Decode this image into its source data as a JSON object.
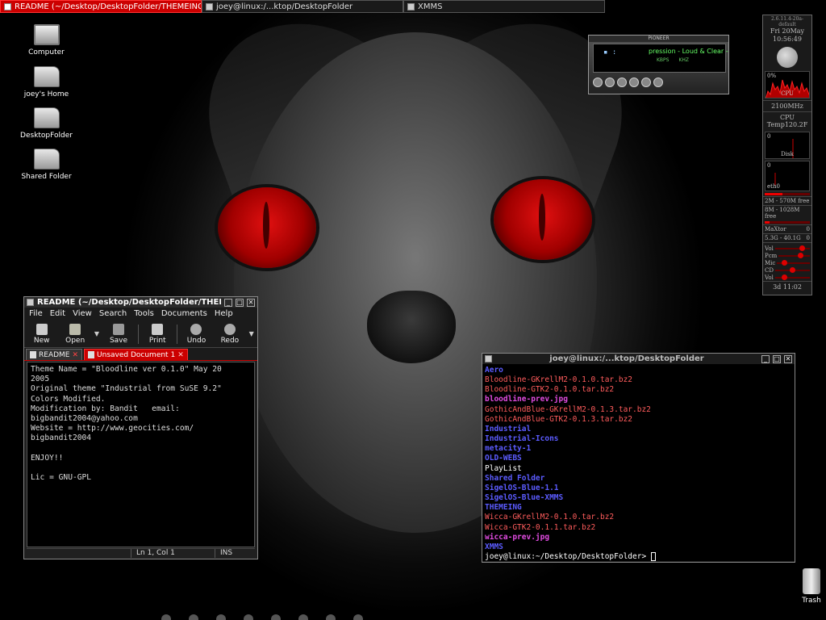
{
  "taskbar": [
    {
      "label": "README (~/Desktop/DesktopFolder/THEMEING/Blo...",
      "active": true
    },
    {
      "label": "joey@linux:/...ktop/DesktopFolder",
      "active": false
    },
    {
      "label": "XMMS",
      "active": false
    }
  ],
  "desktop_icons": [
    {
      "label": "Computer",
      "icon": "computer-icon"
    },
    {
      "label": "joey's Home",
      "icon": "home-folder-icon"
    },
    {
      "label": "DesktopFolder",
      "icon": "folder-icon"
    },
    {
      "label": "Shared Folder",
      "icon": "folder-icon"
    }
  ],
  "trash": {
    "label": "Trash"
  },
  "gedit": {
    "title": "README (~/Desktop/DesktopFolder/THEMEING/",
    "menu": [
      "File",
      "Edit",
      "View",
      "Search",
      "Tools",
      "Documents",
      "Help"
    ],
    "toolbar": {
      "new": "New",
      "open": "Open",
      "save": "Save",
      "print": "Print",
      "undo": "Undo",
      "redo": "Redo"
    },
    "tabs": [
      {
        "label": "README",
        "active": false
      },
      {
        "label": "Unsaved Document 1",
        "active": true
      }
    ],
    "content": "Theme Name = \"Bloodline ver 0.1.0\" May 20\n2005\nOriginal theme \"Industrial from SuSE 9.2\"\nColors Modified.\nModification by: Bandit   email:\nbigbandit2004@yahoo.com\nWebsite = http://www.geocities.com/\nbigbandit2004\n\nENJOY!!\n\nLic = GNU-GPL",
    "status": {
      "position": "Ln 1, Col 1",
      "mode": "INS"
    }
  },
  "terminal": {
    "title": "joey@linux:/...ktop/DesktopFolder",
    "lines": [
      {
        "text": "Aero",
        "kind": "dir"
      },
      {
        "text": "Bloodline-GKrellM2-0.1.0.tar.bz2",
        "kind": "arch"
      },
      {
        "text": "Bloodline-GTK2-0.1.0.tar.bz2",
        "kind": "arch"
      },
      {
        "text": "bloodline-prev.jpg",
        "kind": "img-f"
      },
      {
        "text": "GothicAndBlue-GKrellM2-0.1.3.tar.bz2",
        "kind": "arch"
      },
      {
        "text": "GothicAndBlue-GTK2-0.1.3.tar.bz2",
        "kind": "arch"
      },
      {
        "text": "Industrial",
        "kind": "dir"
      },
      {
        "text": "Industrial-Icons",
        "kind": "dir"
      },
      {
        "text": "metacity-1",
        "kind": "dir"
      },
      {
        "text": "OLD-WEBS",
        "kind": "dir"
      },
      {
        "text": "PlayList",
        "kind": "plain"
      },
      {
        "text": "Shared Folder",
        "kind": "dir"
      },
      {
        "text": "SigelOS-Blue-1.1",
        "kind": "dir"
      },
      {
        "text": "SigelOS-Blue-XMMS",
        "kind": "dir"
      },
      {
        "text": "THEMEING",
        "kind": "dir"
      },
      {
        "text": "Wicca-GKrellM2-0.1.0.tar.bz2",
        "kind": "arch"
      },
      {
        "text": "Wicca-GTK2-0.1.1.tar.bz2",
        "kind": "arch"
      },
      {
        "text": "wicca-prev.jpg",
        "kind": "img-f"
      },
      {
        "text": "XMMS",
        "kind": "dir"
      }
    ],
    "prompt": "joey@linux:~/Desktop/DesktopFolder> "
  },
  "xmms": {
    "brand": "PIONEER",
    "time": "▪   :",
    "track": "pression - Loud & Clear -",
    "kbps": "KBPS",
    "khz": "KHZ"
  },
  "gkrellm": {
    "host": "2.6.11.4-20a-default",
    "day": "Fri 20May",
    "time": "10:56:49",
    "cpu_pct": "0%",
    "cpu_label": "CPU",
    "freq": "2100MHz",
    "temp": "CPU Temp120.2F",
    "disk_zero": "0",
    "disk_label": "Disk",
    "net_zero": "0",
    "net_label": "eth0",
    "mem": "2M - 570M free",
    "swap": "8M - 1028M free",
    "mail": "MaXtor",
    "mail_count": "0",
    "fs": "5.3G - 40.1G",
    "fs_count": "0",
    "vol": "Vol",
    "pcm": "Pcm",
    "mic": "Mic",
    "cd": "CD",
    "volm": "Vol",
    "uptime": "3d 11:02"
  }
}
